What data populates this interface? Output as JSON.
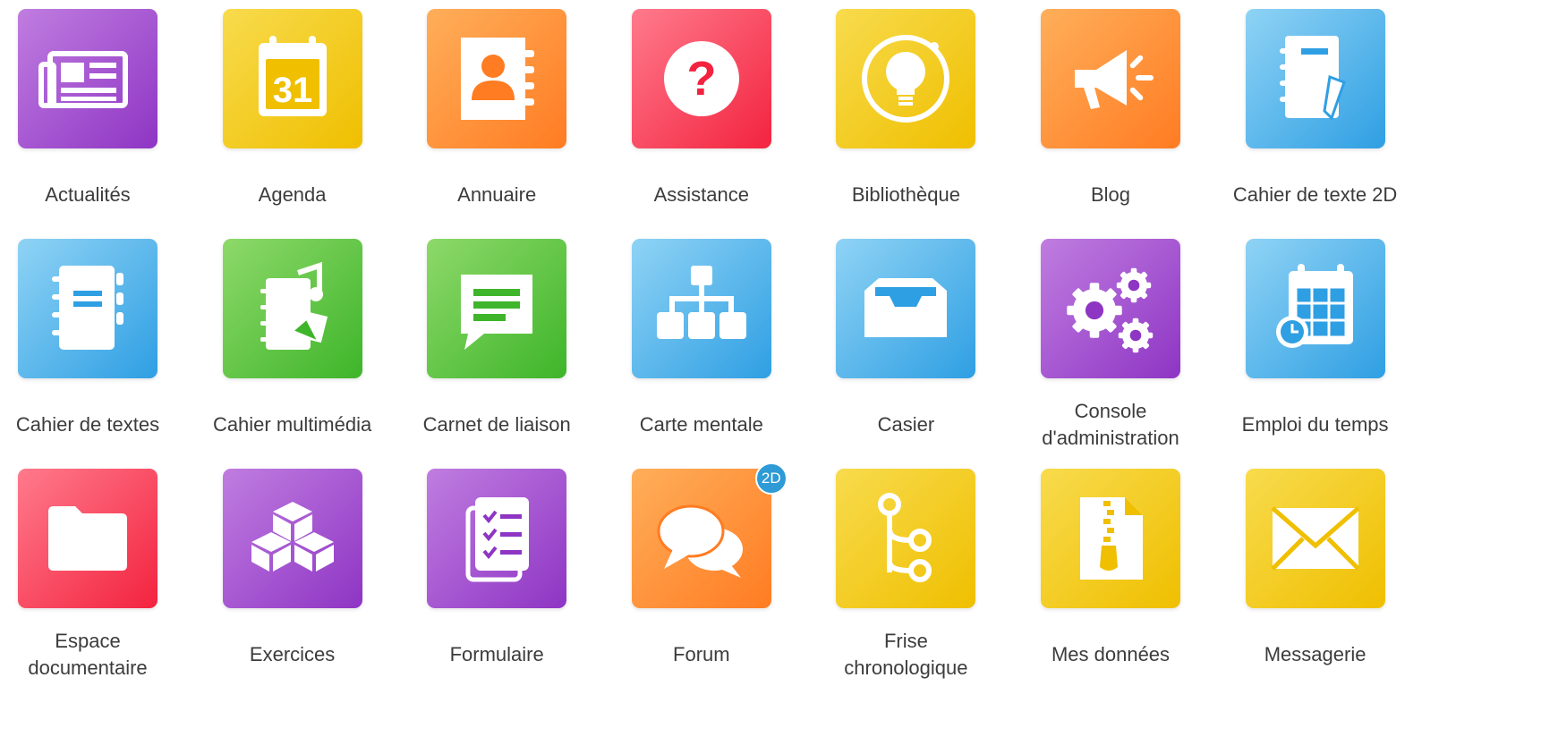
{
  "colors": {
    "purple": [
      "#c07de0",
      "#8e35c4"
    ],
    "yellow": [
      "#f8db4d",
      "#efbf00"
    ],
    "orange": [
      "#ffae5a",
      "#ff7c22"
    ],
    "red": [
      "#ff7a8c",
      "#f3233f"
    ],
    "blue": [
      "#8fd3f5",
      "#2f9fe3"
    ],
    "green": [
      "#8ed96a",
      "#3eb52a"
    ],
    "badge": "#2e9bd6"
  },
  "apps": [
    {
      "id": "actualites",
      "label": "Actualités",
      "color": "purple",
      "icon": "newspaper-icon"
    },
    {
      "id": "agenda",
      "label": "Agenda",
      "color": "yellow",
      "icon": "calendar-icon",
      "icon_text": "31"
    },
    {
      "id": "annuaire",
      "label": "Annuaire",
      "color": "orange",
      "icon": "address-book-icon"
    },
    {
      "id": "assistance",
      "label": "Assistance",
      "color": "red",
      "icon": "help-icon",
      "icon_text": "?"
    },
    {
      "id": "bibliotheque",
      "label": "Bibliothèque",
      "color": "yellow",
      "icon": "lightbulb-icon"
    },
    {
      "id": "blog",
      "label": "Blog",
      "color": "orange",
      "icon": "megaphone-icon"
    },
    {
      "id": "cahier-de-texte-2d",
      "label": "Cahier de texte 2D",
      "color": "blue",
      "icon": "notebook-pen-icon"
    },
    {
      "id": "cahier-de-textes",
      "label": "Cahier de textes",
      "color": "blue",
      "icon": "notebook-icon"
    },
    {
      "id": "cahier-multimedia",
      "label": "Cahier multimédia",
      "color": "green",
      "icon": "multimedia-notebook-icon"
    },
    {
      "id": "carnet-de-liaison",
      "label": "Carnet de liaison",
      "color": "green",
      "icon": "speech-bubble-icon"
    },
    {
      "id": "carte-mentale",
      "label": "Carte mentale",
      "color": "blue",
      "icon": "sitemap-icon"
    },
    {
      "id": "casier",
      "label": "Casier",
      "color": "blue",
      "icon": "inbox-tray-icon"
    },
    {
      "id": "console-administration",
      "label": "Console\nd'administration",
      "color": "purple",
      "icon": "gears-icon"
    },
    {
      "id": "emploi-du-temps",
      "label": "Emploi du temps",
      "color": "blue",
      "icon": "schedule-icon"
    },
    {
      "id": "espace-documentaire",
      "label": "Espace\ndocumentaire",
      "color": "red",
      "icon": "folder-icon"
    },
    {
      "id": "exercices",
      "label": "Exercices",
      "color": "purple",
      "icon": "cubes-icon"
    },
    {
      "id": "formulaire",
      "label": "Formulaire",
      "color": "purple",
      "icon": "checklist-icon"
    },
    {
      "id": "forum",
      "label": "Forum",
      "color": "orange",
      "icon": "chat-bubbles-icon",
      "badge": "2D"
    },
    {
      "id": "frise-chronologique",
      "label": "Frise\nchronologique",
      "color": "yellow",
      "icon": "timeline-icon"
    },
    {
      "id": "mes-donnees",
      "label": "Mes données",
      "color": "yellow",
      "icon": "zip-file-icon"
    },
    {
      "id": "messagerie",
      "label": "Messagerie",
      "color": "yellow",
      "icon": "envelope-icon"
    }
  ]
}
